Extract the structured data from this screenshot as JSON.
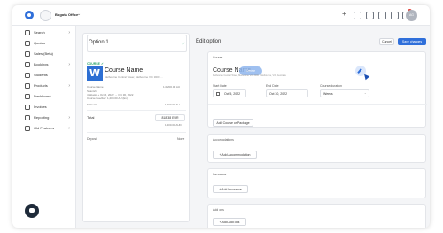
{
  "topbar": {
    "office_name": "Bogotá Office",
    "office_chevron": "chevron-down-icon",
    "plus_icon": "plus-icon",
    "user_initials": "AG"
  },
  "sidebar": {
    "items": [
      {
        "label": "Search",
        "icon": "search-icon",
        "arrow": "›"
      },
      {
        "label": "Quotes",
        "icon": "quote-icon",
        "arrow": ""
      },
      {
        "label": "Sales (Beta)",
        "icon": "sales-icon",
        "arrow": ""
      },
      {
        "label": "Bookings",
        "icon": "booking-icon",
        "arrow": "›"
      },
      {
        "label": "Students",
        "icon": "students-icon",
        "arrow": ""
      },
      {
        "label": "Products",
        "icon": "products-icon",
        "arrow": "›"
      },
      {
        "label": "Dashboard",
        "icon": "dashboard-icon",
        "arrow": ""
      },
      {
        "label": "Invoices",
        "icon": "invoice-icon",
        "arrow": ""
      },
      {
        "label": "Reporting",
        "icon": "reporting-icon",
        "arrow": "›"
      },
      {
        "label": "Old Features",
        "icon": "old-features-icon",
        "arrow": "›"
      }
    ]
  },
  "option": {
    "title": "Option 1",
    "tag": "COURSE ✓",
    "course_name": "Course Name",
    "course_address": "Melbourne Central Tower, Melbourne VIC 3000 ...",
    "line1_label": "Course Name",
    "line1_value": "1.0 200.00 AU",
    "line2": "Spanish",
    "line3": "4 Weeks + Oct 5, 2022 → Oct 30, 2022",
    "line4": "Course Fee/day: 1,200.00 AU (Ex)",
    "line5_label": "Subtotal",
    "line5_value": "1,200.00 AU",
    "total_label": "Total",
    "total_value": "818.38 EUR",
    "total_sub": "1,200.00 AUD",
    "deposit_label": "Deposit",
    "deposit_value": "None"
  },
  "edit": {
    "title": "Edit option",
    "cancel": "Cancel",
    "save": "Save changes"
  },
  "course_panel": {
    "title": "Course",
    "course_name": "Course Name",
    "hover_label": "Delete",
    "course_sub": "Melbourne Central Tower, Melbourne VIC 3000 · Melbourne, VIC, Australia",
    "start_label": "Start Date",
    "start_value": "Oct 5, 2022",
    "end_label": "End Date",
    "end_value": "Oct 30, 2022",
    "duration_label": "Course duration",
    "duration_value": "Weeks",
    "add_label": "Add Course or Package"
  },
  "accommodation_panel": {
    "title": "Accomodations",
    "add_label": "+ Add Accommodation"
  },
  "insurance_panel": {
    "title": "Insurance",
    "add_label": "+ Add Insurance"
  },
  "addons_panel": {
    "title": "Add ons",
    "add_label": "+ Add Add ons"
  }
}
